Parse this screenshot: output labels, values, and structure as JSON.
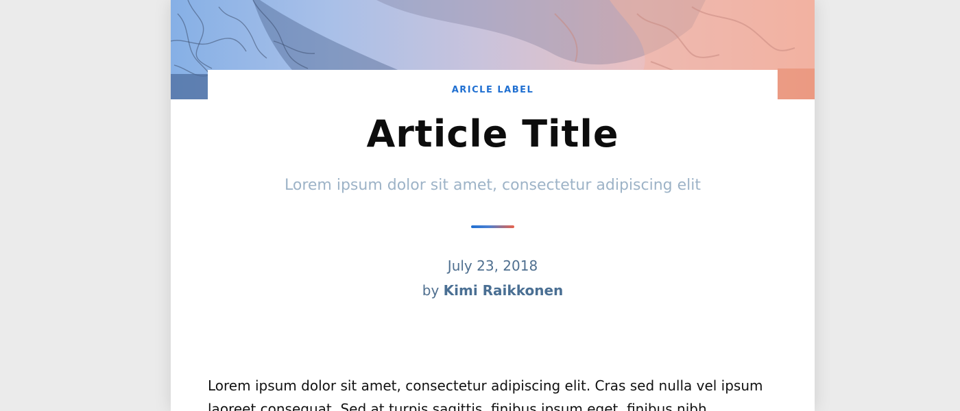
{
  "article": {
    "label": "ARICLE LABEL",
    "title": "Article Title",
    "subtitle": "Lorem ipsum dolor sit amet, consectetur adipiscing elit",
    "date": "July 23, 2018",
    "by_prefix": "by",
    "author": "Kimi Raikkonen",
    "body": "Lorem ipsum dolor sit amet, consectetur adipiscing elit. Cras sed nulla vel ipsum laoreet consequat. Sed at turpis sagittis, finibus ipsum eget, finibus nibh."
  },
  "colors": {
    "label": "#1f6fd1",
    "subtitle": "#9db3c7",
    "meta": "#4f6f8f",
    "divider_start": "#1f6fd1",
    "divider_end": "#e8624b"
  },
  "icons": {
    "hero": "hero-photo-image"
  }
}
